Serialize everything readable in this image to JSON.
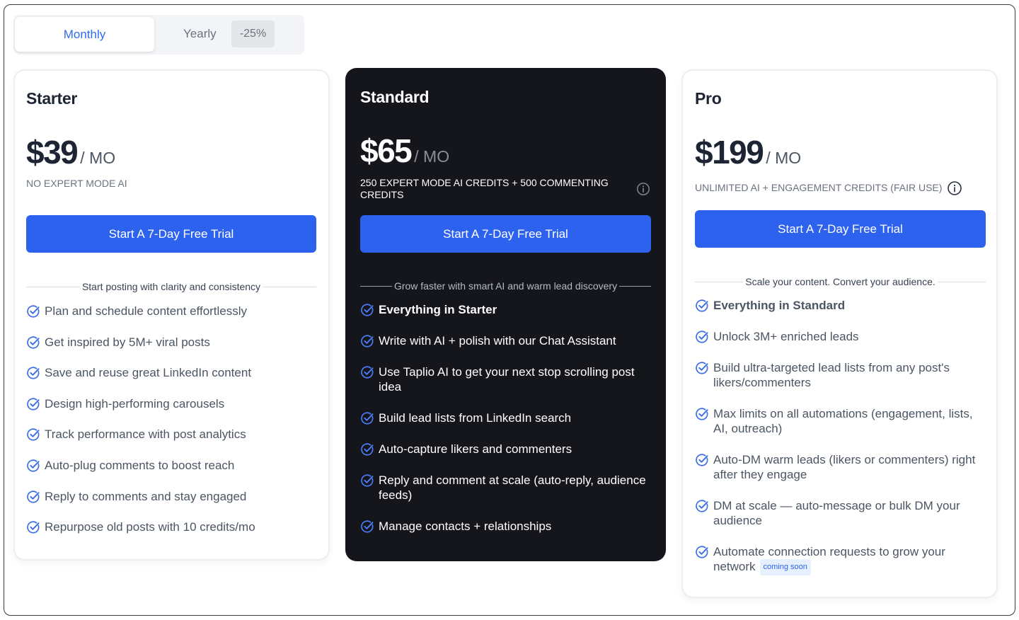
{
  "billing_toggle": {
    "monthly_label": "Monthly",
    "yearly_label": "Yearly",
    "yearly_discount": "-25%",
    "selected": "Monthly"
  },
  "plans": {
    "starter": {
      "name": "Starter",
      "price": "$39",
      "period": "/ MO",
      "credits": "NO EXPERT MODE AI",
      "cta": "Start A 7-Day Free Trial",
      "tagline": "Start posting with clarity and consistency",
      "features": [
        "Plan and schedule content effortlessly",
        "Get inspired by 5M+ viral posts",
        "Save and reuse great LinkedIn content",
        "Design high-performing carousels",
        "Track performance with post analytics",
        "Auto-plug comments to boost reach",
        "Reply to comments and stay engaged",
        "Repurpose old posts with 10 credits/mo"
      ]
    },
    "standard": {
      "name": "Standard",
      "price": "$65",
      "period": "/ MO",
      "credits": "250 EXPERT MODE AI CREDITS + 500 COMMENTING CREDITS",
      "cta": "Start A 7-Day Free Trial",
      "tagline": "Grow faster with smart AI and warm lead discovery",
      "features": [
        "Everything in Starter",
        "Write with AI + polish with our Chat Assistant",
        "Use Taplio AI to get your next stop scrolling post idea",
        "Build lead lists from LinkedIn search",
        "Auto-capture likers and commenters",
        "Reply and comment at scale (auto-reply, audience feeds)",
        "Manage contacts + relationships"
      ]
    },
    "pro": {
      "name": "Pro",
      "price": "$199",
      "period": "/ MO",
      "credits": "UNLIMITED AI + ENGAGEMENT CREDITS (FAIR USE)",
      "cta": "Start A 7-Day Free Trial",
      "tagline": "Scale your content. Convert your audience.",
      "features": [
        "Everything in Standard",
        "Unlock 3M+ enriched leads",
        "Build ultra-targeted lead lists from any post's likers/commenters",
        "Max limits on all automations (engagement, lists, AI, outreach)",
        "Auto-DM warm leads (likers or commenters) right after they engage",
        "DM at scale — auto-message or bulk DM your audience",
        "Automate connection requests to grow your network"
      ],
      "coming_soon_badge": "coming soon"
    }
  },
  "colors": {
    "accent": "#2d62ef",
    "dark_card": "#15151c",
    "check_light": "#3b6ee8",
    "check_dark": "#4a7cf5"
  },
  "icons": {
    "feature_check": "circle-check-icon",
    "info": "info-icon"
  }
}
